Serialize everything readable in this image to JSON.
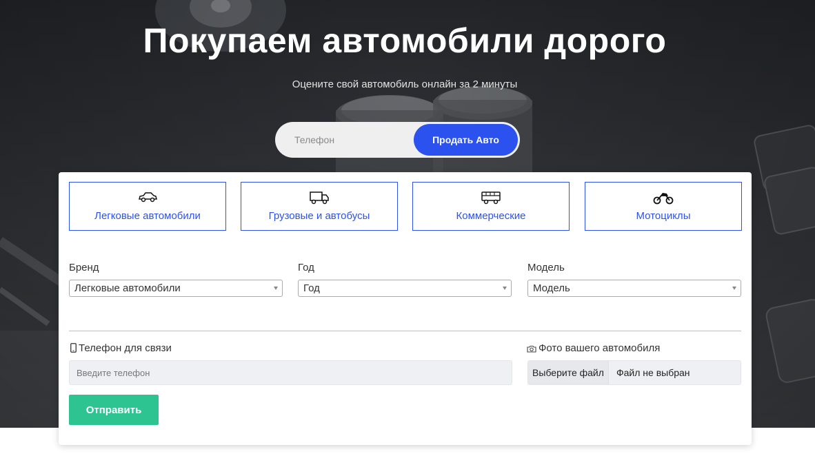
{
  "hero": {
    "title": "Покупаем автомобили дорого",
    "subtitle": "Оцените свой автомобиль онлайн за 2 минуты",
    "phone_placeholder": "Телефон",
    "sell_button": "Продать Авто"
  },
  "categories": [
    {
      "icon": "car-icon",
      "label": "Легковые автомобили"
    },
    {
      "icon": "truck-icon",
      "label": "Грузовые и автобусы"
    },
    {
      "icon": "bus-icon",
      "label": "Коммерческие"
    },
    {
      "icon": "motorcycle-icon",
      "label": "Мотоциклы"
    }
  ],
  "form": {
    "brand_label": "Бренд",
    "brand_value": "Легковые автомобили",
    "year_label": "Год",
    "year_value": "Год",
    "model_label": "Модель",
    "model_value": "Модель",
    "contact_phone_label": "Телефон для связи",
    "contact_phone_placeholder": "Введите телефон",
    "photo_label": "Фото вашего автомобиля",
    "file_button": "Выберите файл",
    "file_status": "Файл не выбран",
    "submit": "Отправить"
  },
  "colors": {
    "accent": "#2b52ef",
    "submit": "#2dc492"
  }
}
